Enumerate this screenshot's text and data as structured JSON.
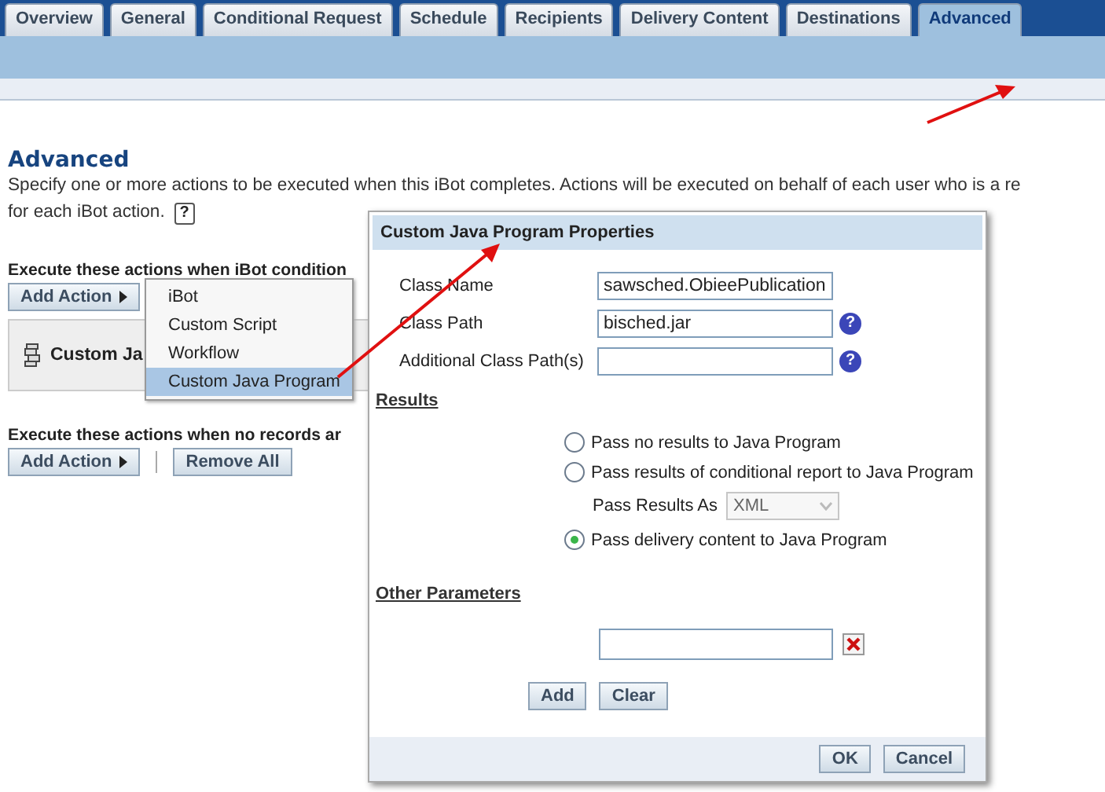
{
  "tabs": [
    {
      "label": "Overview",
      "selected": false
    },
    {
      "label": "General",
      "selected": false
    },
    {
      "label": "Conditional Request",
      "selected": false
    },
    {
      "label": "Schedule",
      "selected": false
    },
    {
      "label": "Recipients",
      "selected": false
    },
    {
      "label": "Delivery Content",
      "selected": false
    },
    {
      "label": "Destinations",
      "selected": false
    },
    {
      "label": "Advanced",
      "selected": true
    }
  ],
  "page": {
    "title": "Advanced",
    "description_lines": [
      "Specify one or more actions to be executed when this iBot completes. Actions will be executed on behalf of each user who is a re",
      "for each iBot action."
    ],
    "help_icon": "?"
  },
  "sections": [
    {
      "label": "Execute these actions when iBot condition",
      "buttons": [
        {
          "label": "Add Action",
          "kind": "menu"
        }
      ],
      "actions": [
        {
          "name": "Custom Ja"
        }
      ]
    },
    {
      "label": "Execute these actions when no records ar",
      "buttons": [
        {
          "label": "Add Action",
          "kind": "menu"
        },
        {
          "label": "Remove All",
          "kind": "plain"
        }
      ]
    }
  ],
  "menu": {
    "items": [
      {
        "label": "iBot",
        "selected": false
      },
      {
        "label": "Custom Script",
        "selected": false
      },
      {
        "label": "Workflow",
        "selected": false
      },
      {
        "label": "Custom Java Program",
        "selected": true
      }
    ]
  },
  "dialog": {
    "title": "Custom Java Program Properties",
    "fields": [
      {
        "label": "Class Name",
        "value": "sawsched.ObieePublication"
      },
      {
        "label": "Class Path",
        "value": "bisched.jar",
        "help": "?"
      },
      {
        "label": "Additional Class Path(s)",
        "help": "?"
      }
    ],
    "results_heading": "Results",
    "options": [
      {
        "label": "Pass no results to Java Program",
        "selected": false
      },
      {
        "label": "Pass results of conditional report to Java Program",
        "selected": false
      },
      {
        "label": "Pass delivery content to Java Program",
        "selected": true
      }
    ],
    "pass_results_as": {
      "label": "Pass Results As",
      "value": "XML",
      "disabled": true
    },
    "other_heading": "Other Parameters",
    "param_buttons": [
      "Add",
      "Clear"
    ],
    "footer_buttons": [
      "OK",
      "Cancel"
    ]
  }
}
